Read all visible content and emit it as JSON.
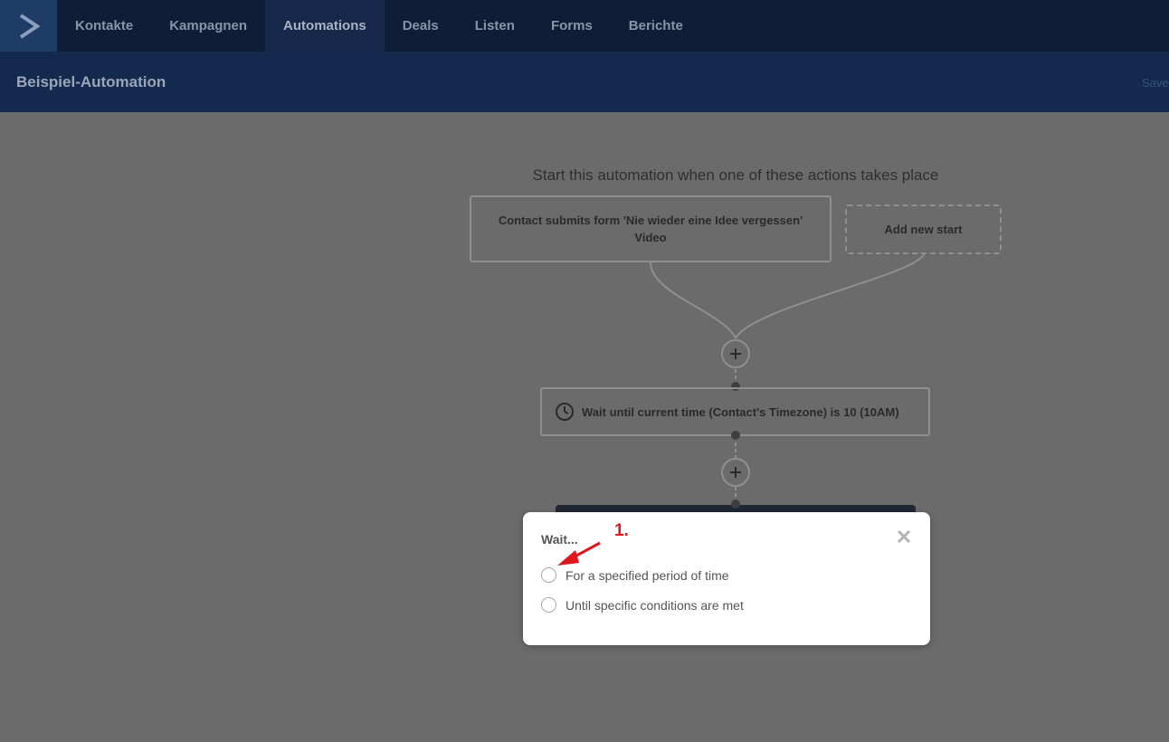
{
  "nav": {
    "logo_icon": "activecampaign-chevron-icon",
    "items": [
      {
        "label": "Kontakte"
      },
      {
        "label": "Kampagnen"
      },
      {
        "label": "Automations",
        "active": true
      },
      {
        "label": "Deals"
      },
      {
        "label": "Listen"
      },
      {
        "label": "Forms"
      },
      {
        "label": "Berichte"
      }
    ]
  },
  "subheader": {
    "title": "Beispiel-Automation",
    "save_label": "Save"
  },
  "canvas": {
    "start_heading": "Start this automation when one of these actions takes place",
    "trigger_label": "Contact submits form 'Nie wieder eine Idee vergessen' Video",
    "add_start_label": "Add new start",
    "wait_node_label": "Wait until current time (Contact's Timezone) is 10 (10AM)"
  },
  "modal": {
    "title": "Wait...",
    "options": [
      {
        "label": "For a specified period of time",
        "selected": false
      },
      {
        "label": "Until specific conditions are met",
        "selected": false
      }
    ]
  },
  "annotation": {
    "label": "1.",
    "color": "#e0161b"
  },
  "colors": {
    "nav_bg": "#0d1e36",
    "subheader_bg": "#132a4e",
    "overlay_bg": "#6b6b6b"
  }
}
